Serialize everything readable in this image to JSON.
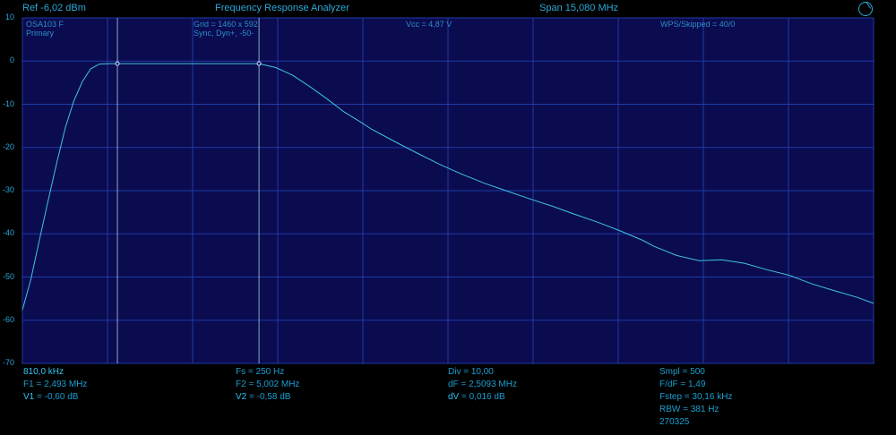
{
  "header": {
    "ref": "Ref  -6,02 dBm",
    "title": "Frequency Response Analyzer",
    "span": "Span 15,080 MHz"
  },
  "plot_info": {
    "device": "OSA103 F",
    "trace": "Primary",
    "grid": "Grid = 1460 x 592",
    "sync": "Sync,  Dyn+,  -50-",
    "vcc": "Vcc = 4,87 V",
    "wps": "WPS/Skipped  = 40/0"
  },
  "y_ticks": [
    "10",
    "0",
    "-10",
    "-20",
    "-30",
    "-40",
    "-50",
    "-60",
    "-70"
  ],
  "footer": {
    "start_freq": "810,0 kHz",
    "f1": "F1 = 2,493 MHz",
    "v1_key": "V1",
    "v1_val": " = -0,60 dB",
    "fs": "Fs = 250 Hz",
    "f2": "F2 = 5,002 MHz",
    "v2_key": "V2",
    "v2_val": " = -0,58 dB",
    "div": "Div = 10,00",
    "df": "dF = 2,5093 MHz",
    "dv_key": "dV",
    "dv_val": " = 0,016 dB",
    "smpl": "Smpl = 500",
    "fdf": "F/dF = 1,49",
    "fstep": "Fstep = 30,16 kHz",
    "rbw": "RBW = 381 Hz",
    "date": "270325"
  },
  "colors": {
    "background": "#000000",
    "plot_bg": "#0b0b50",
    "grid": "#1e3ba5",
    "trace": "#3cc6de",
    "text": "#1b9fd0"
  },
  "icons": {
    "settings": "knob-icon"
  },
  "chart_data": {
    "type": "line",
    "x_unit": "MHz",
    "y_unit": "dB",
    "xlim": [
      0.81,
      15.89
    ],
    "ylim": [
      -70,
      10
    ],
    "grid": true,
    "markers": [
      {
        "name": "V1",
        "x": 2.493,
        "y": -0.6
      },
      {
        "name": "V2",
        "x": 5.002,
        "y": -0.58
      }
    ],
    "series": [
      {
        "x": [
          0.81,
          0.96,
          1.11,
          1.26,
          1.42,
          1.57,
          1.72,
          1.87,
          2.02,
          2.17,
          2.33,
          2.49,
          2.8,
          3.1,
          3.4,
          3.7,
          4.0,
          4.3,
          4.6,
          5.0,
          5.3,
          5.6,
          5.9,
          6.2,
          6.5,
          6.8,
          7.0,
          7.4,
          7.8,
          8.2,
          8.6,
          9.0,
          9.4,
          9.8,
          10.2,
          10.6,
          11.0,
          11.4,
          11.8,
          12.0,
          12.4,
          12.8,
          13.2,
          13.6,
          14.0,
          14.4,
          14.8,
          15.2,
          15.6,
          15.89
        ],
        "y": [
          -57.6,
          -50.6,
          -41.5,
          -32.7,
          -23.5,
          -15.4,
          -9.3,
          -4.8,
          -1.8,
          -0.7,
          -0.6,
          -0.6,
          -0.6,
          -0.6,
          -0.6,
          -0.6,
          -0.6,
          -0.6,
          -0.6,
          -0.6,
          -1.5,
          -3.3,
          -5.9,
          -8.7,
          -11.7,
          -14.1,
          -15.8,
          -18.6,
          -21.3,
          -23.9,
          -26.2,
          -28.3,
          -30.1,
          -31.9,
          -33.6,
          -35.5,
          -37.3,
          -39.3,
          -41.5,
          -42.9,
          -45.0,
          -46.2,
          -46.0,
          -46.8,
          -48.3,
          -49.6,
          -51.6,
          -53.2,
          -54.7,
          -56.1
        ]
      }
    ]
  }
}
